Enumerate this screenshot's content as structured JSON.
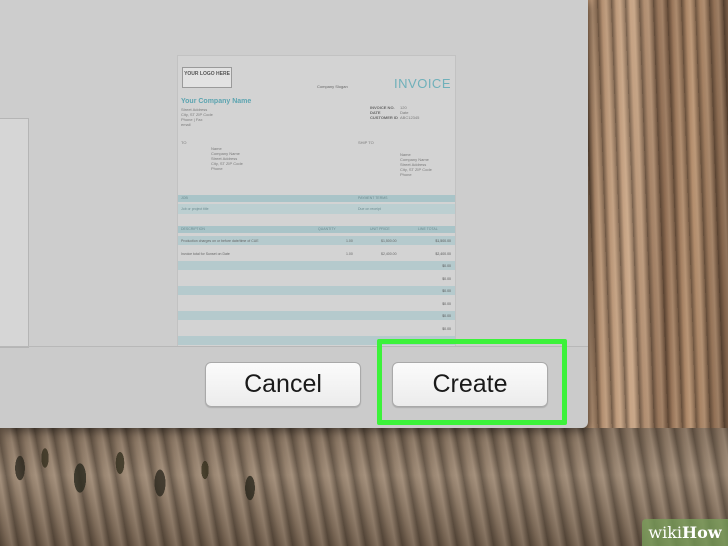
{
  "dialog": {
    "cancel_label": "Cancel",
    "create_label": "Create"
  },
  "invoice": {
    "logo_text": "YOUR LOGO HERE",
    "title": "INVOICE",
    "slogan": "Company Slogan",
    "company_name": "Your Company Name",
    "address_lines": [
      "Street Address",
      "City, ST ZIP Code",
      "Phone | Fax",
      "email"
    ],
    "meta": [
      {
        "label": "INVOICE NO.",
        "value": "120"
      },
      {
        "label": "DATE",
        "value": "Date"
      },
      {
        "label": "CUSTOMER ID",
        "value": "ABC12345"
      }
    ],
    "to_label": "TO",
    "ship_label": "SHIP TO",
    "to_lines": [
      "Name",
      "Company Name",
      "Street Address",
      "City, ST ZIP Code",
      "Phone"
    ],
    "ship_lines": [
      "Name",
      "Company Name",
      "Street Address",
      "City, ST ZIP Code",
      "Phone"
    ],
    "job_label": "JOB",
    "payment_terms_label": "PAYMENT TERMS",
    "job_value": "Job or project title",
    "terms_value": "Due on receipt",
    "columns": [
      "DESCRIPTION",
      "QUANTITY",
      "UNIT PRICE",
      "LINE TOTAL"
    ],
    "items": [
      {
        "desc": "Production charges on or before date/time of CUE",
        "qty": "1.00",
        "price": "$1,500.00",
        "total": "$1,500.00"
      },
      {
        "desc": "Invoice total for Sunset on Date",
        "qty": "1.00",
        "price": "$2,400.00",
        "total": "$2,400.00"
      }
    ],
    "empty_total": "$0.00"
  },
  "watermark": {
    "wiki": "wiki",
    "how": "How"
  },
  "colors": {
    "highlight": "#3cf23a",
    "invoice_accent": "#6fb0ba"
  }
}
